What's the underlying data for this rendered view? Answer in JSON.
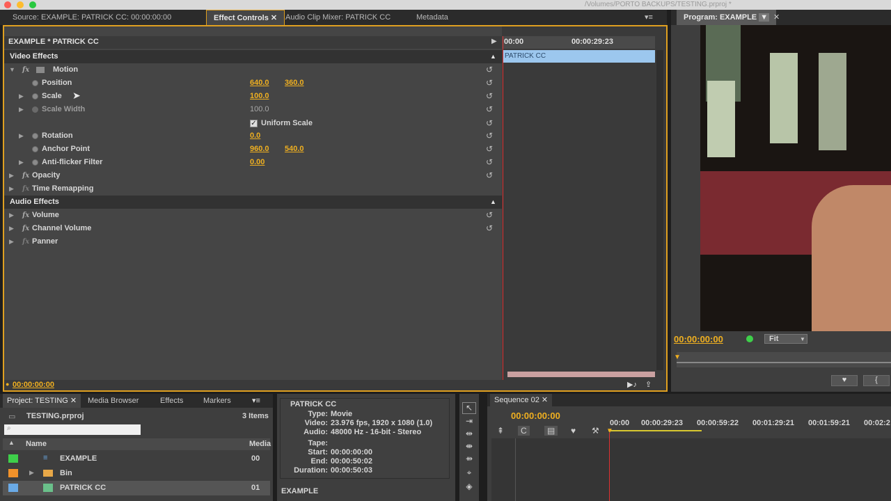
{
  "window": {
    "path": "/Volumes/PORTO BACKUPS/TESTING.prproj *"
  },
  "top_tabs": [
    {
      "label": "Source: EXAMPLE: PATRICK CC: 00:00:00:00"
    },
    {
      "label": "Effect Controls"
    },
    {
      "label": "Audio Clip Mixer: PATRICK CC"
    },
    {
      "label": "Metadata"
    }
  ],
  "program_tab": {
    "label": "Program: EXAMPLE"
  },
  "effect_controls": {
    "header": "EXAMPLE * PATRICK CC",
    "time_start": "00:00",
    "time_mark": "00:00:29:23",
    "clip_name": "PATRICK CC",
    "timecode": "00:00:00:00",
    "video_effects": "Video Effects",
    "audio_effects": "Audio Effects",
    "motion": "Motion",
    "position": {
      "label": "Position",
      "x": "640.0",
      "y": "360.0"
    },
    "scale": {
      "label": "Scale",
      "value": "100.0"
    },
    "scale_width": {
      "label": "Scale Width",
      "value": "100.0"
    },
    "uniform_scale": {
      "label": "Uniform Scale",
      "checked": true
    },
    "rotation": {
      "label": "Rotation",
      "value": "0.0"
    },
    "anchor_point": {
      "label": "Anchor Point",
      "x": "960.0",
      "y": "540.0"
    },
    "anti_flicker": {
      "label": "Anti-flicker Filter",
      "value": "0.00"
    },
    "opacity": "Opacity",
    "time_remapping": "Time Remapping",
    "volume": "Volume",
    "channel_volume": "Channel Volume",
    "panner": "Panner"
  },
  "program": {
    "timecode": "00:00:00:00",
    "zoom": "Fit"
  },
  "project": {
    "tabs": [
      "Project: TESTING",
      "Media Browser",
      "Effects",
      "Markers"
    ],
    "file": "TESTING.prproj",
    "items_count": "3 Items",
    "search_placeholder": "",
    "col_name": "Name",
    "col_media": "Media",
    "rows": [
      {
        "name": "EXAMPLE",
        "media": "00",
        "color": "#3ecf4a"
      },
      {
        "name": "Bin",
        "media": "",
        "color": "#f2922a"
      },
      {
        "name": "PATRICK CC",
        "media": "01",
        "color": "#6aaae6"
      }
    ]
  },
  "info": {
    "title": "PATRICK CC",
    "type_label": "Type:",
    "type": "Movie",
    "video_label": "Video:",
    "video": "23.976 fps, 1920 x 1080 (1.0)",
    "audio_label": "Audio:",
    "audio": "48000 Hz - 16-bit - Stereo",
    "tape_label": "Tape:",
    "start_label": "Start:",
    "start": "00:00:00:00",
    "end_label": "End:",
    "end": "00:00:50:02",
    "duration_label": "Duration:",
    "duration": "00:00:50:03",
    "footer": "EXAMPLE"
  },
  "sequence": {
    "tab": "Sequence 02",
    "timecode": "00:00:00:00",
    "ruler": [
      "00:00",
      "00:00:29:23",
      "00:00:59:22",
      "00:01:29:21",
      "00:01:59:21",
      "00:02:2"
    ]
  },
  "colors": {
    "accent": "#e0a020",
    "timecode": "#f0b020",
    "clip": "#9cc7ee"
  }
}
